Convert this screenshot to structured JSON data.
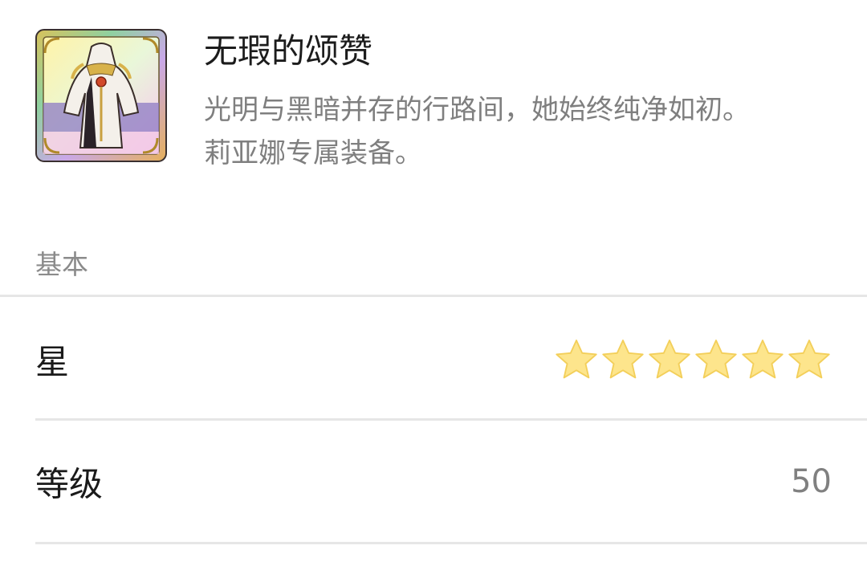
{
  "item": {
    "name": "无瑕的颂赞",
    "description_lines": [
      "光明与黑暗并存的行路间，她始终纯净如初。",
      "莉亚娜专属装备。"
    ],
    "icon": "white-dress-equipment-icon"
  },
  "basic_section": {
    "title": "基本",
    "star_row": {
      "label": "星",
      "stars": 6,
      "star_color": "#fde58c"
    },
    "level_row": {
      "label": "等级",
      "value": "50"
    }
  },
  "colors": {
    "divider": "#e6e6e6",
    "label_text": "#1a1a1a",
    "muted_text": "#808080"
  }
}
